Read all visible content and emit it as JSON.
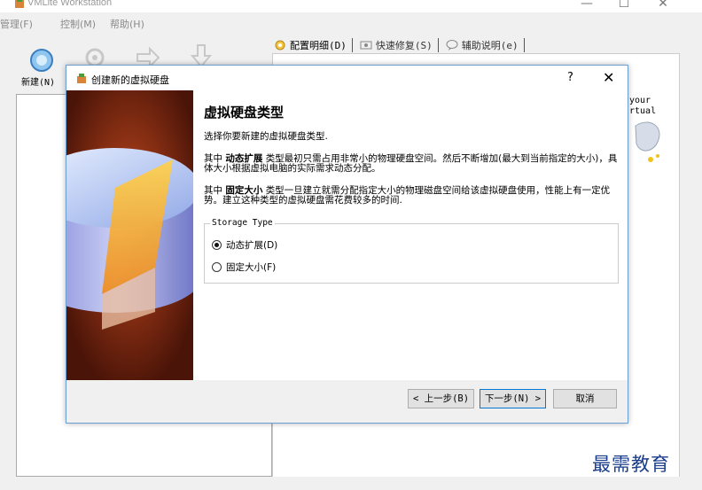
{
  "app": {
    "title": "VMLite Workstation",
    "minimize": "—",
    "maximize": "☐",
    "close": "✕"
  },
  "menu": [
    "管理(F)",
    "控制(M)",
    "帮助(H)"
  ],
  "toolbar": {
    "new_label": "新建(N)"
  },
  "tabs": [
    {
      "label": "配置明细(D)",
      "icon": "gear-icon"
    },
    {
      "label": "快速修复(S)",
      "icon": "camera-icon"
    },
    {
      "label": "辅助说明(e)",
      "icon": "chat-icon"
    }
  ],
  "right_snippet": [
    "your",
    "rtual"
  ],
  "dialog": {
    "title": "创建新的虚拟硬盘",
    "help": "?",
    "close": "✕",
    "back": "←",
    "heading": "虚拟硬盘类型",
    "intro": "选择你要新建的虚拟硬盘类型.",
    "dynamic_prefix": "其中",
    "dynamic_term": "动态扩展",
    "dynamic_text": "类型最初只需占用非常小的物理硬盘空间。然后不断增加(最大到当前指定的大小)，具体大小根据虚拟电脑的实际需求动态分配。",
    "fixed_prefix": "其中",
    "fixed_term": "固定大小",
    "fixed_text": "类型一旦建立就需分配指定大小的物理磁盘空间给该虚拟硬盘使用，性能上有一定优势。建立这种类型的虚拟硬盘需花费较多的时间.",
    "group_label": "Storage Type",
    "options": [
      {
        "label": "动态扩展(D)",
        "selected": true
      },
      {
        "label": "固定大小(F)",
        "selected": false
      }
    ],
    "buttons": {
      "back": "< 上一步(B)",
      "next": "下一步(N) >",
      "cancel": "取消"
    }
  },
  "watermark": "最需教育",
  "colors": {
    "side_panel": "#5a1b0c",
    "watermark": "#1a3d8c",
    "dialog_border": "#6a9fd4"
  }
}
